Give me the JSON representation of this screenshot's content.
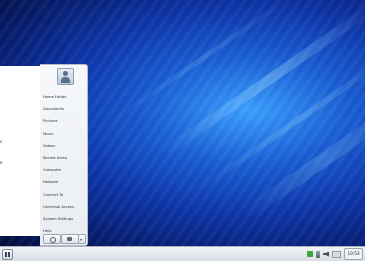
{
  "start_menu": {
    "items": [
      "Home Folder",
      "Documents",
      "Pictures",
      "Music",
      "Videos",
      "Recent Items",
      "Computer",
      "Network",
      "Connect To",
      "Universal Access",
      "System Settings",
      "Help"
    ]
  },
  "taskbar": {
    "clock": "10:53"
  }
}
